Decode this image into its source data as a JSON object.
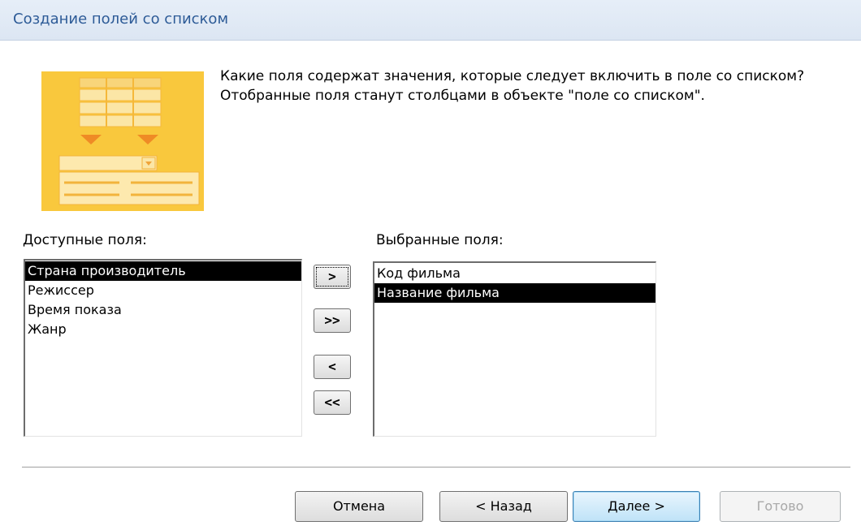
{
  "title": "Создание полей со списком",
  "question": "Какие поля содержат значения, которые следует включить в поле со списком? Отобранные поля станут столбцами в объекте \"поле со списком\".",
  "available": {
    "label": "Доступные поля:",
    "items": [
      "Страна производитель",
      "Режиссер",
      "Время показа",
      "Жанр"
    ],
    "selected_index": 0
  },
  "selected_fields": {
    "label": "Выбранные поля:",
    "items": [
      "Код фильма",
      "Название фильма"
    ],
    "selected_index": 1
  },
  "move_buttons": {
    "add_one": ">",
    "add_all": ">>",
    "remove_one": "<",
    "remove_all": "<<"
  },
  "footer": {
    "cancel": "Отмена",
    "back": "< Назад",
    "next": "Далее >",
    "finish": "Готово"
  },
  "colors": {
    "title": "#2d5b97",
    "wizard_image": "#f9c83d",
    "selection": "#000000"
  }
}
